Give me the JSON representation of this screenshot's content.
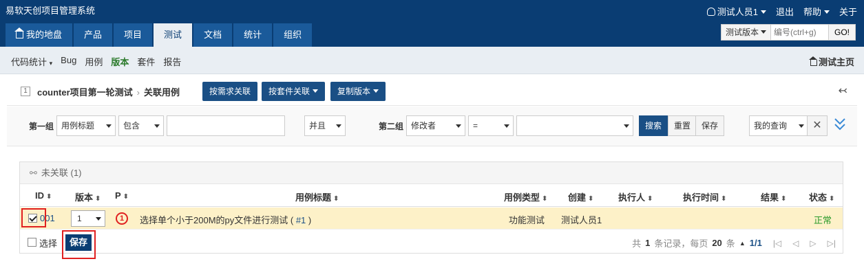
{
  "app": {
    "title": "易软天创项目管理系统"
  },
  "top_right": {
    "user": "测试人员1",
    "logout": "退出",
    "help": "帮助",
    "about": "关于"
  },
  "main_nav": [
    "我的地盘",
    "产品",
    "项目",
    "测试",
    "文档",
    "统计",
    "组织"
  ],
  "main_nav_active": "测试",
  "search": {
    "scope": "测试版本",
    "placeholder": "编号(ctrl+g)",
    "go": "GO!"
  },
  "sub_nav": {
    "items": [
      "代码统计",
      "Bug",
      "用例",
      "版本",
      "套件",
      "报告"
    ],
    "active": "版本",
    "home": "测试主页"
  },
  "title_bar": {
    "id": "1",
    "build": "counter项目第一轮测试",
    "sep": "›",
    "page": "关联用例",
    "btn_story": "按需求关联",
    "btn_suite": "按套件关联",
    "btn_copy": "复制版本",
    "back": "↢"
  },
  "query": {
    "group1_label": "第一组",
    "group1_field": "用例标题",
    "group1_op": "包含",
    "logic": "并且",
    "group2_label": "第二组",
    "group2_field": "修改者",
    "group2_op": "=",
    "search": "搜索",
    "reset": "重置",
    "save": "保存",
    "my_query": "我的查询",
    "close": "✕"
  },
  "panel": {
    "title": "未关联 (1)",
    "columns": [
      "ID",
      "版本",
      "P",
      "用例标题",
      "用例类型",
      "创建",
      "执行人",
      "执行时间",
      "结果",
      "状态"
    ],
    "rows": [
      {
        "id": "001",
        "version": "1",
        "priority": "1",
        "title": "选择单个小于200M的py文件进行测试",
        "title_ref": "#1",
        "type": "功能测试",
        "creator": "测试人员1",
        "executor": "",
        "exec_time": "",
        "result": "",
        "status": "正常",
        "checked": true
      }
    ],
    "footer": {
      "select_label": "选择",
      "save": "保存",
      "total_pre": "共",
      "total": "1",
      "total_post": "条记录，每页",
      "per_page": "20",
      "per_page_post": "条",
      "page": "1/1"
    }
  },
  "colors": {
    "header": "#0a3d73",
    "accent": "#1a4f85",
    "highlight_row": "#fdf1c8",
    "red_frame": "#e02020"
  }
}
